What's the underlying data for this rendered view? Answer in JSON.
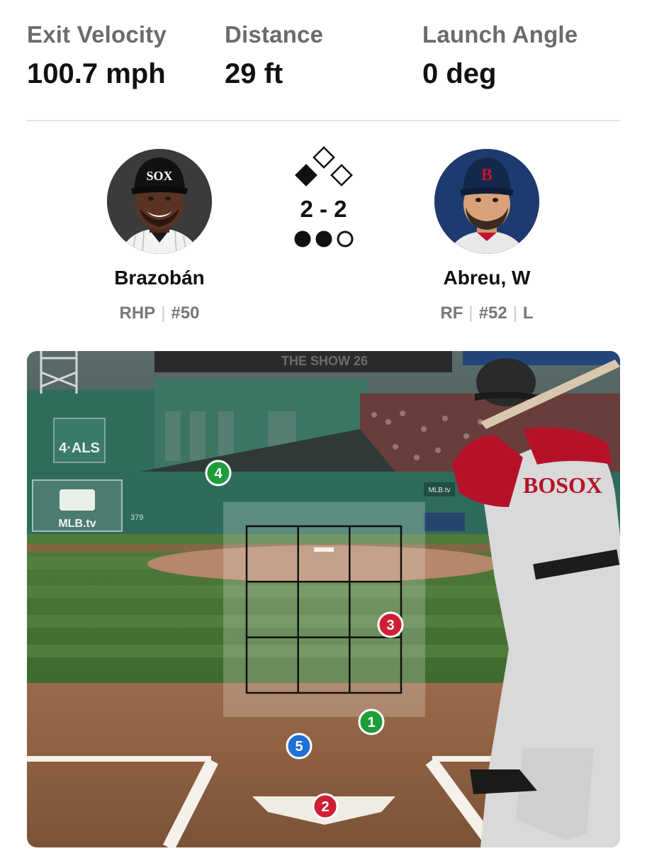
{
  "stats": {
    "exit_velocity": {
      "label": "Exit Velocity",
      "value": "100.7 mph"
    },
    "distance": {
      "label": "Distance",
      "value": "29 ft"
    },
    "launch_angle": {
      "label": "Launch Angle",
      "value": "0 deg"
    }
  },
  "pitcher": {
    "name": "Brazobán",
    "throws": "RHP",
    "number": "#50",
    "cap_logo": "SOX"
  },
  "batter": {
    "name": "Abreu, W",
    "position": "RF",
    "number": "#52",
    "bats": "L",
    "cap_logo": "B"
  },
  "situation": {
    "count": "2 - 2",
    "bases": {
      "first": true,
      "second": false,
      "third": false
    },
    "outs": {
      "filled": 2,
      "total": 3
    }
  },
  "scene": {
    "signs": [
      "4·ALS",
      "MLB.tv",
      "379",
      "MLB.tv",
      "THE SHOW 26"
    ],
    "jersey_text": "BOSOX"
  },
  "pitches": [
    {
      "number": "1",
      "result": "ball",
      "color": "#1f9d3a"
    },
    {
      "number": "2",
      "result": "strike",
      "color": "#cf1f37"
    },
    {
      "number": "3",
      "result": "strike",
      "color": "#cf1f37"
    },
    {
      "number": "4",
      "result": "ball",
      "color": "#1f9d3a"
    },
    {
      "number": "5",
      "result": "in-play",
      "color": "#1f6fd6"
    }
  ],
  "colors": {
    "ball": "#1f9d3a",
    "strike": "#cf1f37",
    "in_play": "#1f6fd6",
    "label": "#6b6b6b"
  }
}
